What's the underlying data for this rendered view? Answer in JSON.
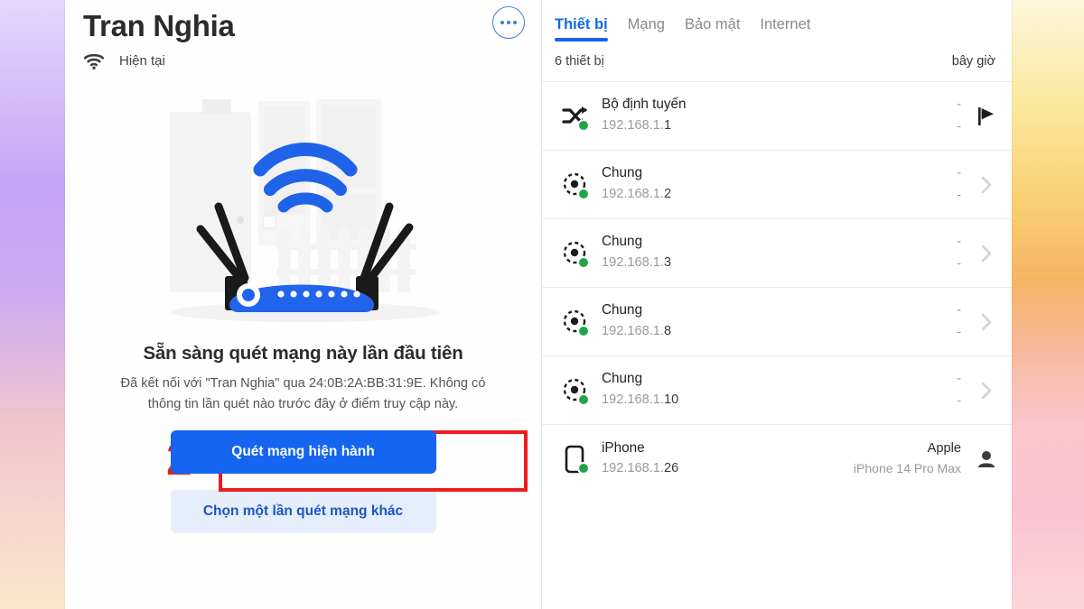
{
  "left": {
    "network_name": "Tran Nghia",
    "status_label": "Hiện tại",
    "wifi_icon": "wifi-icon",
    "more_icon": "more-options-icon",
    "illustration_name": "router-wifi-illustration",
    "promo_title": "Sẵn sàng quét mạng này lần đầu tiên",
    "promo_body": "Đã kết nối với \"Tran Nghia\" qua 24:0B:2A:BB:31:9E. Không có thông tin lần quét nào trước đây ở điểm truy cập này.",
    "step_number": "2",
    "primary_button": "Quét mạng hiện hành",
    "secondary_button": "Chọn một lần quét mạng khác"
  },
  "right": {
    "tabs": [
      {
        "label": "Thiết bị",
        "active": true
      },
      {
        "label": "Mạng",
        "active": false
      },
      {
        "label": "Bảo mật",
        "active": false
      },
      {
        "label": "Internet",
        "active": false
      }
    ],
    "count_label": "6 thiết bị",
    "timestamp": "bây giờ",
    "devices": [
      {
        "name": "Bộ định tuyến",
        "ip_prefix": "192.168.1.",
        "ip_last": "1",
        "vendor": "-",
        "model": "-",
        "icon": "router-shuffle-icon",
        "action_icon": "flag-icon",
        "online": true
      },
      {
        "name": "Chung",
        "ip_prefix": "192.168.1.",
        "ip_last": "2",
        "vendor": "-",
        "model": "-",
        "icon": "generic-device-icon",
        "action_icon": "chevron-right-icon",
        "online": true
      },
      {
        "name": "Chung",
        "ip_prefix": "192.168.1.",
        "ip_last": "3",
        "vendor": "-",
        "model": "-",
        "icon": "generic-device-icon",
        "action_icon": "chevron-right-icon",
        "online": true
      },
      {
        "name": "Chung",
        "ip_prefix": "192.168.1.",
        "ip_last": "8",
        "vendor": "-",
        "model": "-",
        "icon": "generic-device-icon",
        "action_icon": "chevron-right-icon",
        "online": true
      },
      {
        "name": "Chung",
        "ip_prefix": "192.168.1.",
        "ip_last": "10",
        "vendor": "-",
        "model": "-",
        "icon": "generic-device-icon",
        "action_icon": "chevron-right-icon",
        "online": true
      },
      {
        "name": "iPhone",
        "ip_prefix": "192.168.1.",
        "ip_last": "26",
        "vendor": "Apple",
        "model": "iPhone 14 Pro Max",
        "icon": "smartphone-icon",
        "action_icon": "person-icon",
        "online": true
      }
    ]
  },
  "colors": {
    "accent_blue": "#1565f0",
    "annotation_red": "#ee1b1b",
    "online_green": "#22a44b",
    "muted_gray": "#9a9a9a"
  }
}
